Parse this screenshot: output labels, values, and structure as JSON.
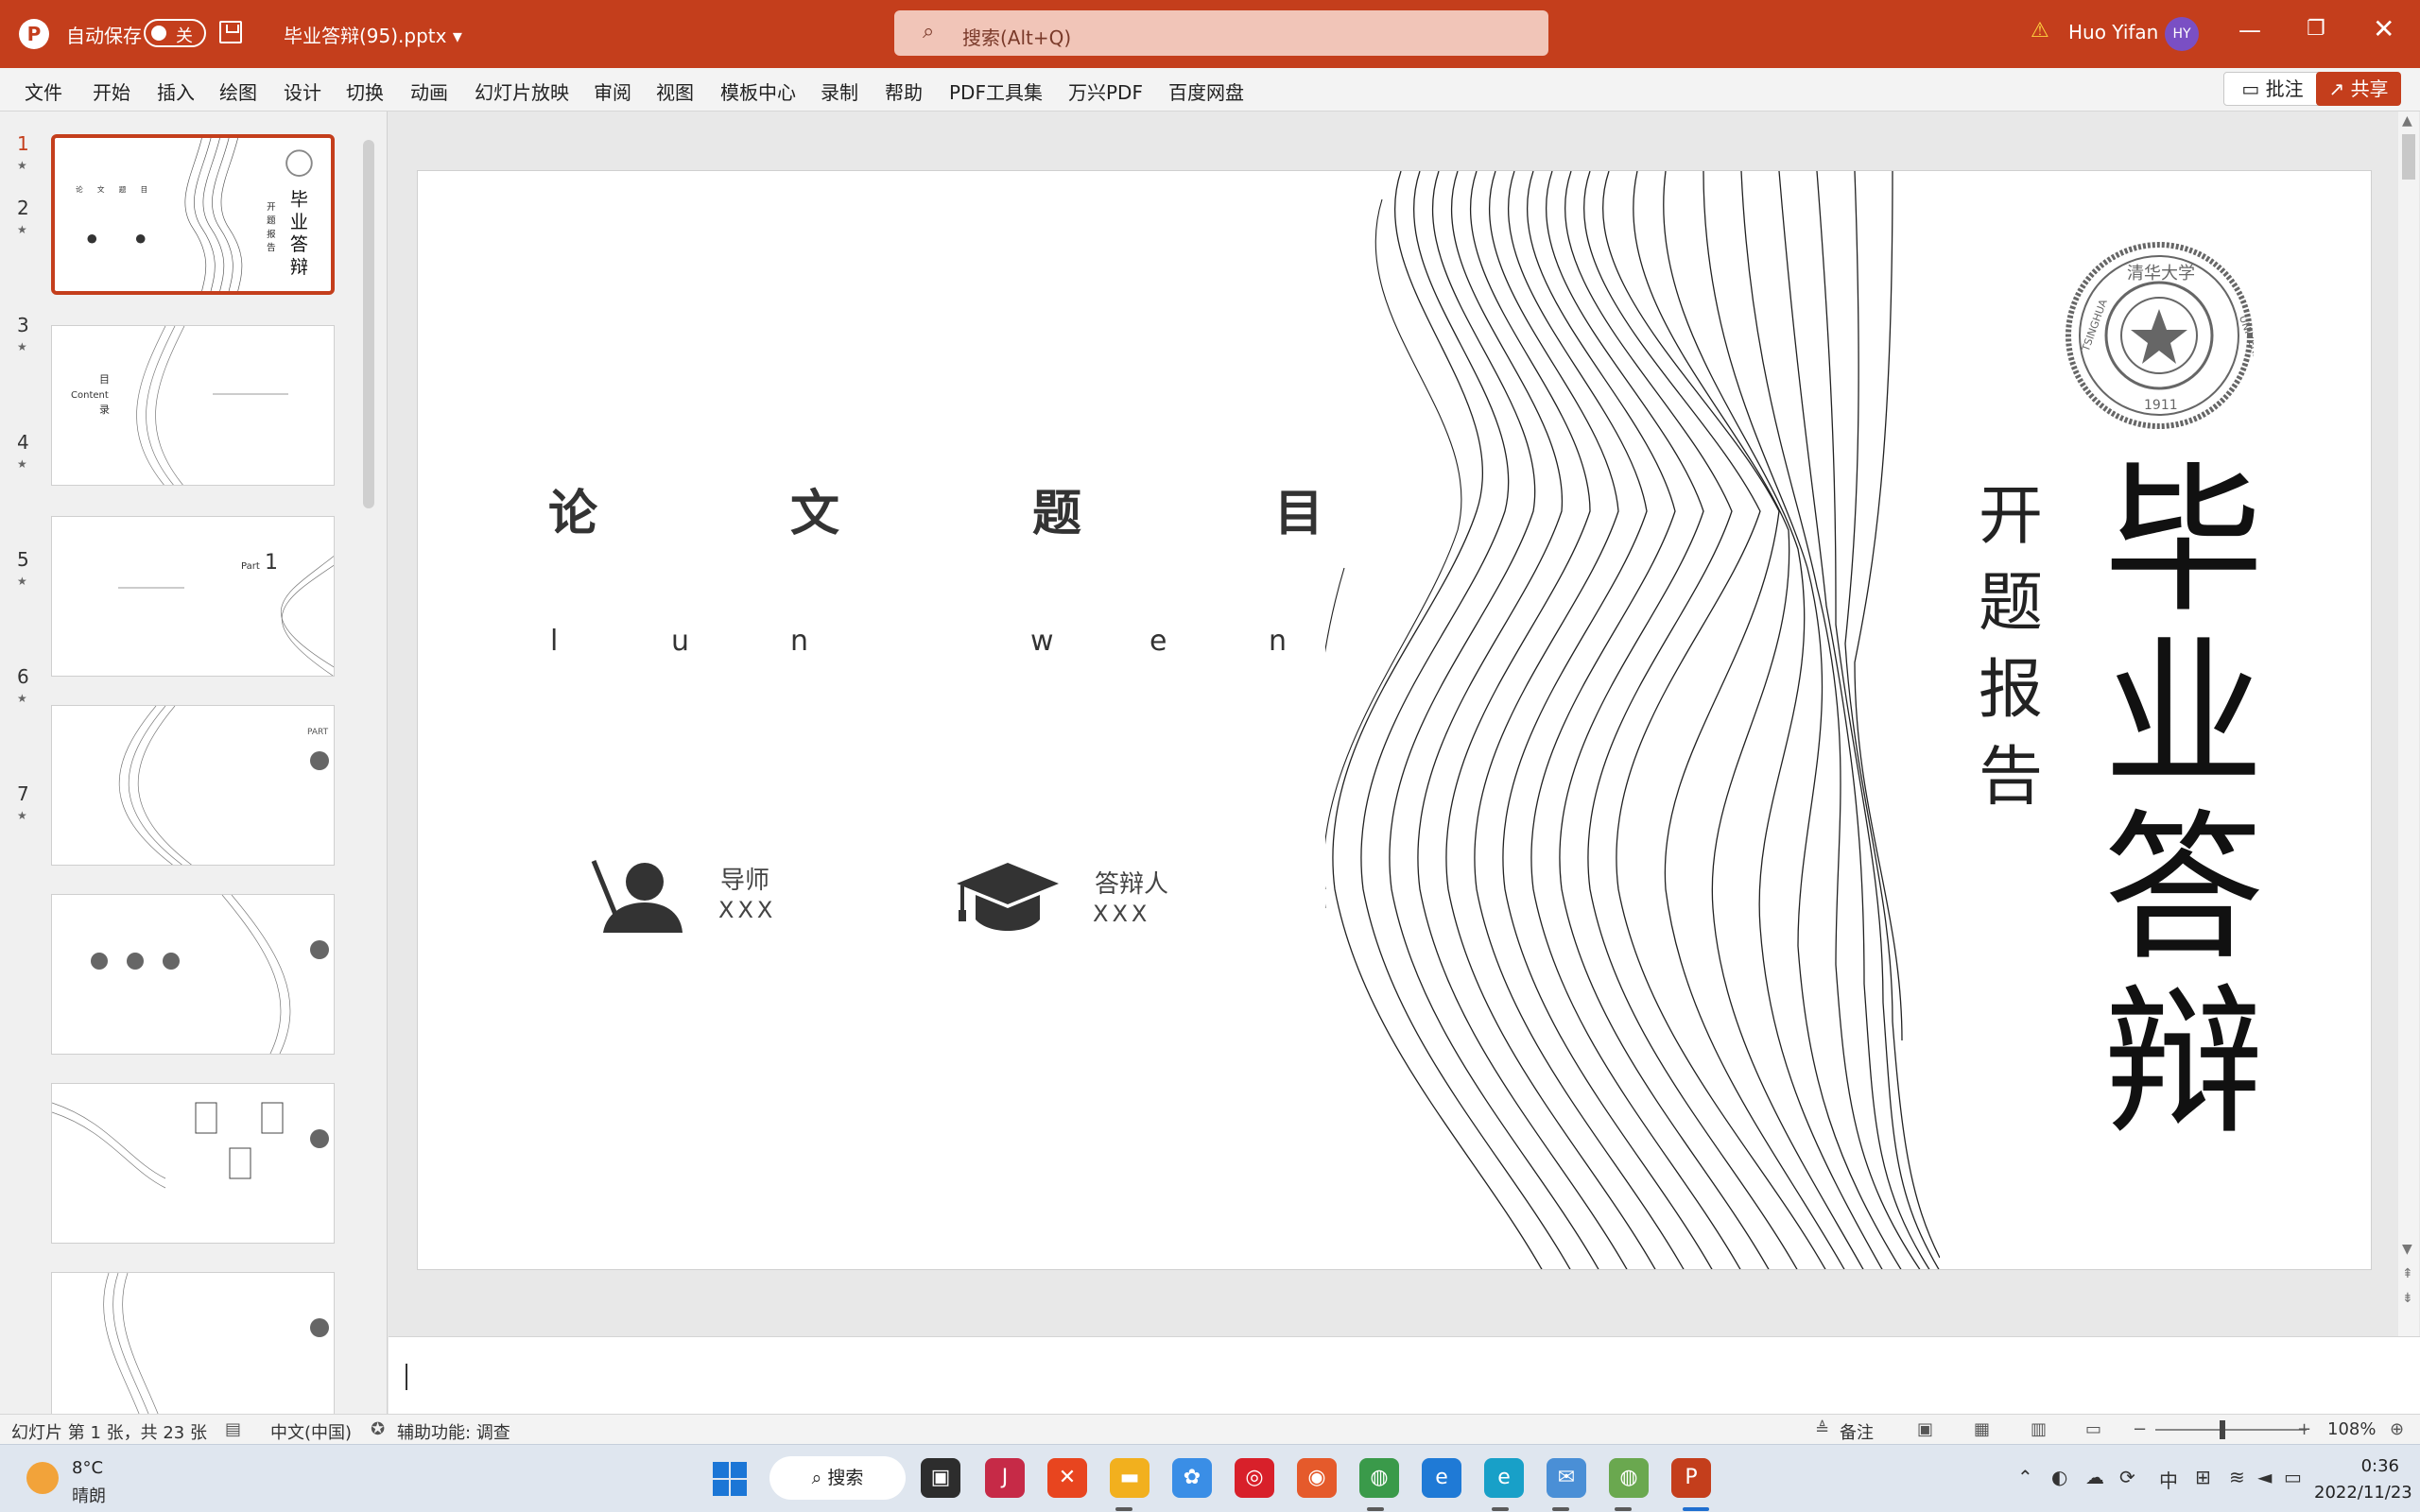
{
  "titlebar": {
    "autosave_label": "自动保存",
    "autosave_state": "关",
    "filename": "毕业答辩(95).pptx ▾",
    "search_placeholder": "搜索(Alt+Q)",
    "user_name": "Huo Yifan",
    "user_initials": "HY",
    "accent_color": "#c43e1c"
  },
  "ribbon": {
    "tabs": [
      "文件",
      "开始",
      "插入",
      "绘图",
      "设计",
      "切换",
      "动画",
      "幻灯片放映",
      "审阅",
      "视图",
      "模板中心",
      "录制",
      "帮助",
      "PDF工具集",
      "万兴PDF",
      "百度网盘"
    ],
    "comment_label": "批注",
    "share_label": "共享"
  },
  "thumbnails": {
    "items": [
      {
        "num": "1",
        "active": true
      },
      {
        "num": "2",
        "active": false
      },
      {
        "num": "3",
        "active": false
      },
      {
        "num": "4",
        "active": false
      },
      {
        "num": "5",
        "active": false
      },
      {
        "num": "6",
        "active": false
      },
      {
        "num": "7",
        "active": false
      }
    ],
    "slide2_content": "Content",
    "slide3_part": "Part",
    "slide3_num": "1",
    "part_label": "PART"
  },
  "slide": {
    "title_chars": [
      "论",
      "文",
      "题",
      "目"
    ],
    "pinyin_chars": [
      "l",
      "u",
      "n",
      "w",
      "e",
      "n"
    ],
    "advisor_role": "导师",
    "advisor_name": "XXX",
    "defender_role": "答辩人",
    "defender_name": "XXX",
    "vertical_small": [
      "开",
      "题",
      "报",
      "告"
    ],
    "vertical_big": [
      "毕",
      "业",
      "答",
      "辩"
    ],
    "seal_top": "清华大学",
    "seal_left": "TSINGHUA",
    "seal_right": "UNIVERSITY",
    "seal_year": "1911"
  },
  "statusbar": {
    "slide_info": "幻灯片 第 1 张，共 23 张",
    "language": "中文(中国)",
    "accessibility": "辅助功能: 调查",
    "notes_label": "备注",
    "zoom": "108%"
  },
  "taskbar": {
    "temperature": "8°C",
    "weather": "晴朗",
    "search_label": "搜索",
    "ime": "中",
    "time": "0:36",
    "date": "2022/11/23"
  }
}
